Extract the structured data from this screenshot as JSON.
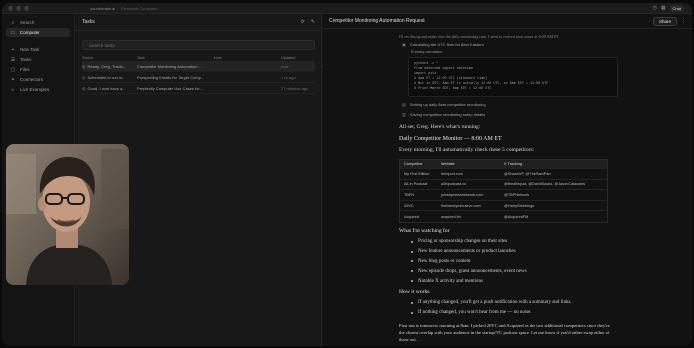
{
  "browser": {
    "url": "yourdomain.ai",
    "tab_label": "Research Computer",
    "chat_label": "Chat"
  },
  "sidebar": {
    "search": "Search",
    "computer": "Computer",
    "new_task": "New Task",
    "tasks": "Tasks",
    "files": "Files",
    "connectors": "Connectors",
    "live_examples": "Live Examples"
  },
  "tasks_panel": {
    "title": "Tasks",
    "search_placeholder": "Search tasks",
    "columns": [
      "Status",
      "Task",
      "Note",
      "Updated"
    ],
    "rows": [
      {
        "status": "Ready, Greg, Tracki...",
        "task": "Competitor Monitoring Automation...",
        "note": "",
        "updated": "now"
      },
      {
        "status": "Scheduled to run in...",
        "task": "Prospecting Emails for Target Comp...",
        "note": "",
        "updated": "1 hr ago"
      },
      {
        "status": "Good, I now have a...",
        "task": "Perplexity Computer Use Cases for...",
        "note": "",
        "updated": "27 minutes ago"
      }
    ]
  },
  "main": {
    "title": "Competitor Monitoring Automation Request",
    "share_label": "Share",
    "faded_line": "I'll set this up and make sure the daily monitoring runs. I need to convert time zones as 6:00 AM ET.",
    "step1": "Calculating the UTC time for 8am Eastern",
    "step1_sub": "Running calculation",
    "code_lines": [
      "python3 -c \"",
      "from datetime import datetime",
      "import pytz",
      "# 8am ET = 12:00 UTC (standard time)",
      "# But in EDT, 8am ET is actually 12:00 UTC, so 8am EST = 13:00 UTC",
      "# Print March EDT, 8am EDT = 12:00 UTC"
    ],
    "step2": "Setting up daily 8am competitor monitoring",
    "step3": "Saving competitor monitoring setup details",
    "intro": "All set, Greg. Here's what's running:",
    "heading": "Daily Competitor Monitor — 8:00 AM ET",
    "lead": "Every morning, I'll automatically check these 5 competitors:",
    "table_headers": [
      "Competitor",
      "Website",
      "X Tracking"
    ],
    "table_rows": [
      [
        "My First Million",
        "mfmpod.com",
        "@ShaanVP, @TheSamParr"
      ],
      [
        "All-In Podcast",
        "allinpodcast.co",
        "@theallinpod, @DavidSacks, @JasonCalacanis"
      ],
      [
        "TBPN",
        "joinsbpnewsnetwork.com",
        "@TBPNetwork"
      ],
      [
        "20VC",
        "thetwentyminutevc.com",
        "@HarryStebbings"
      ],
      [
        "Acquired",
        "acquired.fm",
        "@AcquiredFM"
      ]
    ],
    "watching_heading": "What I'm watching for",
    "watching": [
      "Pricing or sponsorship changes on their sites",
      "New feature announcements or product launches",
      "New blog posts or content",
      "New episode drops, guest announcements, event news",
      "Notable X activity and mentions"
    ],
    "how_heading": "How it works",
    "how": [
      "If anything changed, you'll get a push notification with a summary and links.",
      "If nothing changed, you won't hear from me — no noise."
    ],
    "closing": "First run is tomorrow morning at 8am. I picked 20VC and Acquired as the two additional competitors since they're the closest overlap with your audience in the startup/VC podcast space. Let me know if you'd rather swap either of those out."
  },
  "colors": {
    "background": "#121212",
    "panel": "#181818",
    "sidebar": "#141414"
  }
}
